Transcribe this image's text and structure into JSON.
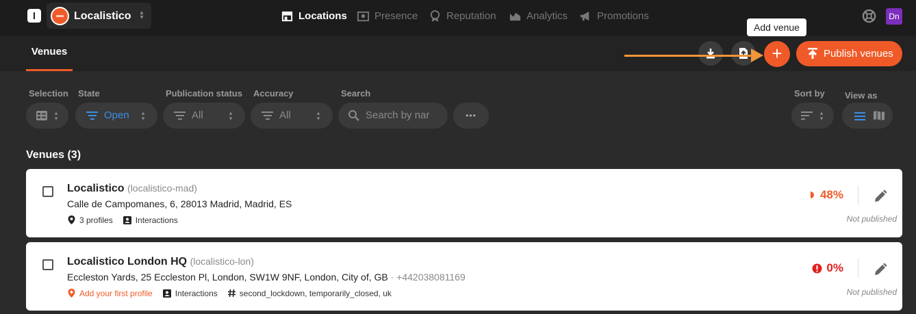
{
  "app": {
    "org_name": "Localistico",
    "user_initials": "Dn",
    "logo_letter": "l"
  },
  "nav": [
    {
      "label": "Locations",
      "icon": "storefront-icon",
      "active": true
    },
    {
      "label": "Presence",
      "icon": "presence-icon",
      "active": false
    },
    {
      "label": "Reputation",
      "icon": "reputation-icon",
      "active": false
    },
    {
      "label": "Analytics",
      "icon": "analytics-icon",
      "active": false
    },
    {
      "label": "Promotions",
      "icon": "megaphone-icon",
      "active": false
    }
  ],
  "subheader": {
    "tab": "Venues",
    "tooltip": "Add venue",
    "add_symbol": "+",
    "publish_label": "Publish venues"
  },
  "filters": {
    "selection_label": "Selection",
    "state_label": "State",
    "state_value": "Open",
    "publication_label": "Publication status",
    "publication_value": "All",
    "accuracy_label": "Accuracy",
    "accuracy_value": "All",
    "search_label": "Search",
    "search_placeholder": "Search by nar",
    "more_label": "•••",
    "sort_label": "Sort by",
    "view_label": "View as"
  },
  "list": {
    "title": "Venues (3)",
    "venues": [
      {
        "name": "Localistico",
        "slug": "(localistico-mad)",
        "address": "Calle de Campomanes, 6, 28013 Madrid, Madrid, ES",
        "phone": "",
        "profiles": "3 profiles",
        "interactions": "Interactions",
        "tags": "",
        "score": "48%",
        "status": "Not published"
      },
      {
        "name": "Localistico London HQ",
        "slug": "(localistico-lon)",
        "address": "Eccleston Yards, 25 Eccleston Pl, London, SW1W 9NF, London, City of, GB",
        "phone": "· +442038081169",
        "profiles": "Add your first profile",
        "interactions": "Interactions",
        "tags": "second_lockdown, temporarily_closed, uk",
        "score": "0%",
        "status": "Not published"
      }
    ]
  },
  "colors": {
    "accent": "#f05a28",
    "blue": "#3a8fe8",
    "danger": "#e02020",
    "arrow": "#f0953a"
  }
}
